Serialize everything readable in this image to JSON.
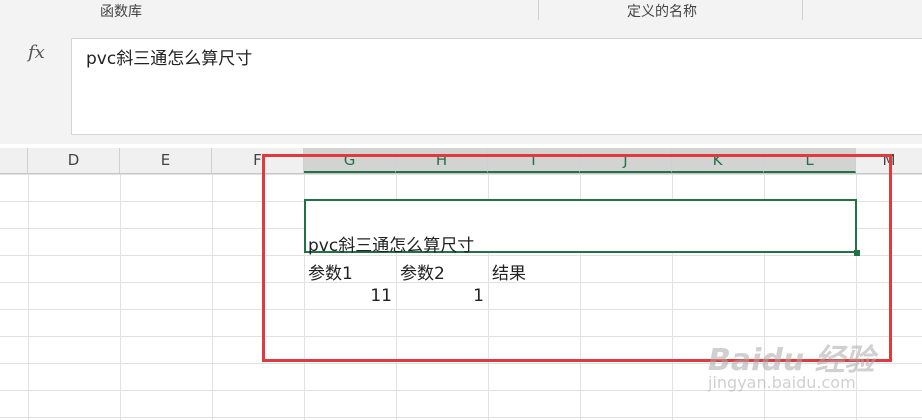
{
  "ribbon": {
    "groups": [
      {
        "label": "函数库"
      },
      {
        "label": "定义的名称"
      }
    ]
  },
  "formula_bar": {
    "fx_label": "fx",
    "value": "pvc斜三通怎么算尺寸"
  },
  "columns": [
    "D",
    "E",
    "F",
    "G",
    "H",
    "I",
    "J",
    "K",
    "L",
    "M"
  ],
  "selected_columns": [
    "G",
    "H",
    "I",
    "J",
    "K",
    "L"
  ],
  "cells": {
    "G5": "pvc斜三通怎么算尺寸",
    "G6": "参数1",
    "H6": "参数2",
    "I6": "结果",
    "G7": "11",
    "H7": "1"
  },
  "colors": {
    "excel_green": "#217346",
    "highlight_red": "#e0393e"
  },
  "watermark": {
    "brand": "Baidu 经验",
    "sub": "jingyan.baidu.com"
  }
}
